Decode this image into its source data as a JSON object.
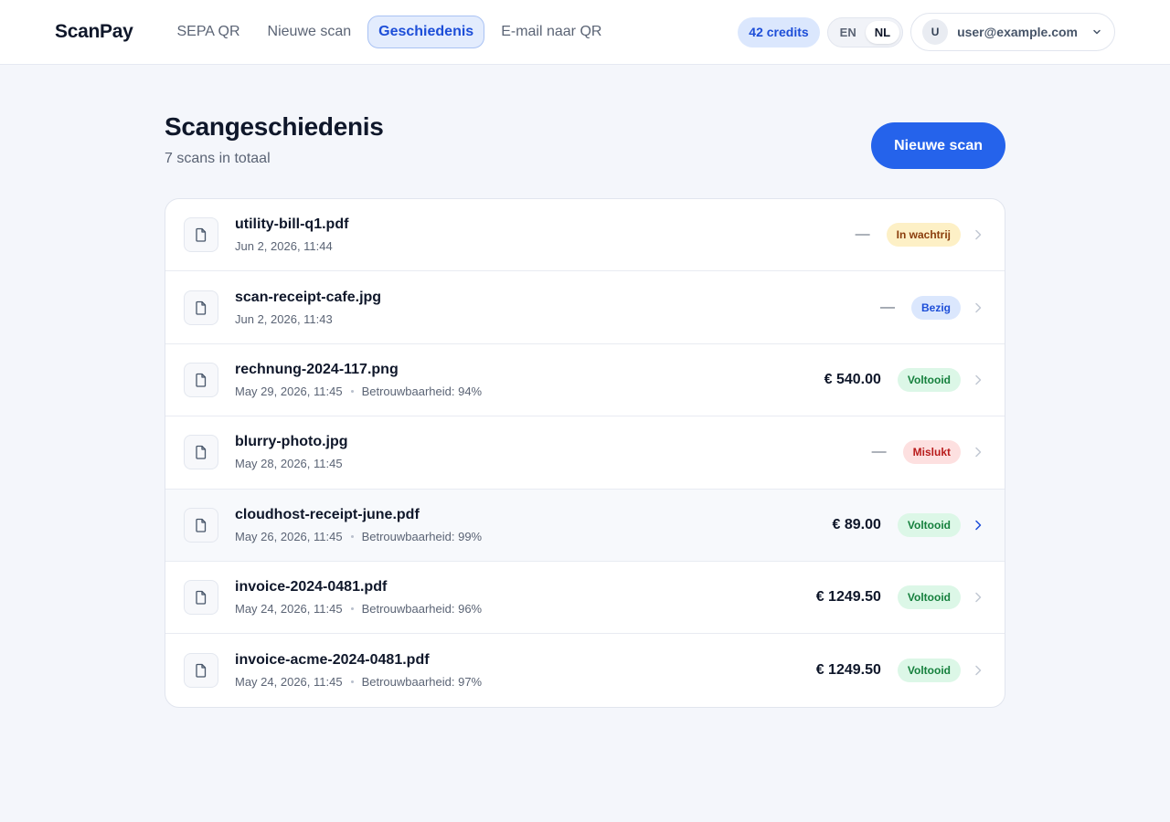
{
  "app": {
    "name": "ScanPay"
  },
  "nav": [
    {
      "label": "SEPA QR",
      "active": false
    },
    {
      "label": "Nieuwe scan",
      "active": false
    },
    {
      "label": "Geschiedenis",
      "active": true
    },
    {
      "label": "E-mail naar QR",
      "active": false
    }
  ],
  "credits": "42 credits",
  "lang": {
    "en": "EN",
    "nl": "NL",
    "selected": "NL"
  },
  "user": {
    "initial": "U",
    "email": "user@example.com"
  },
  "page": {
    "title": "Scangeschiedenis",
    "subtitle": "7 scans in totaal",
    "new_scan_label": "Nieuwe scan"
  },
  "scans": [
    {
      "file": "utility-bill-q1.pdf",
      "date": "Jun 2, 2026, 11:44",
      "confidence": "",
      "amount": "—",
      "status": "In wachtrij",
      "status_type": "queue"
    },
    {
      "file": "scan-receipt-cafe.jpg",
      "date": "Jun 2, 2026, 11:43",
      "confidence": "",
      "amount": "—",
      "status": "Bezig",
      "status_type": "busy"
    },
    {
      "file": "rechnung-2024-117.png",
      "date": "May 29, 2026, 11:45",
      "confidence": "Betrouwbaarheid: 94%",
      "amount": "€ 540.00",
      "status": "Voltooid",
      "status_type": "done"
    },
    {
      "file": "blurry-photo.jpg",
      "date": "May 28, 2026, 11:45",
      "confidence": "",
      "amount": "—",
      "status": "Mislukt",
      "status_type": "fail"
    },
    {
      "file": "cloudhost-receipt-june.pdf",
      "date": "May 26, 2026, 11:45",
      "confidence": "Betrouwbaarheid: 99%",
      "amount": "€ 89.00",
      "status": "Voltooid",
      "status_type": "done",
      "hover": true
    },
    {
      "file": "invoice-2024-0481.pdf",
      "date": "May 24, 2026, 11:45",
      "confidence": "Betrouwbaarheid: 96%",
      "amount": "€ 1249.50",
      "status": "Voltooid",
      "status_type": "done"
    },
    {
      "file": "invoice-acme-2024-0481.pdf",
      "date": "May 24, 2026, 11:45",
      "confidence": "Betrouwbaarheid: 97%",
      "amount": "€ 1249.50",
      "status": "Voltooid",
      "status_type": "done"
    }
  ],
  "colors": {
    "accent": "#2563eb",
    "active_nav_bg": "#e3ecfd",
    "chevron_hover": "#1d4ed8"
  }
}
